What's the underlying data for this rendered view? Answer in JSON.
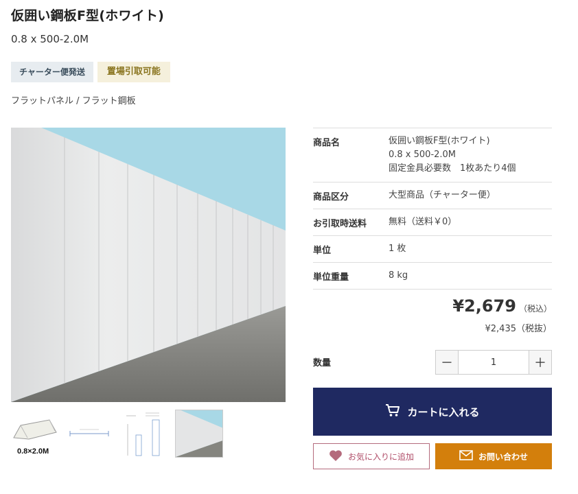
{
  "product": {
    "title": "仮囲い鋼板F型(ホワイト)",
    "subtitle": "0.8 x 500-2.0M",
    "badges": [
      "チャーター便発送",
      "置場引取可能"
    ],
    "category": {
      "items": [
        "フラットパネル",
        "フラット鋼板"
      ],
      "separator": " / "
    }
  },
  "gallery": {
    "thumb_caption": "0.8×2.0M"
  },
  "spec": [
    {
      "label": "商品名",
      "lines": [
        "仮囲い鋼板F型(ホワイト)",
        "0.8 x 500-2.0M",
        "固定金具必要数　1枚あたり4個"
      ]
    },
    {
      "label": "商品区分",
      "lines": [
        "大型商品（チャーター便）"
      ]
    },
    {
      "label": "お引取時送料",
      "lines": [
        "無料（送料￥0）"
      ]
    },
    {
      "label": "単位",
      "lines": [
        "1 枚"
      ]
    },
    {
      "label": "単位重量",
      "lines": [
        "8 kg"
      ]
    }
  ],
  "price": {
    "with_tax": "¥2,679",
    "with_tax_label": "（税込）",
    "without_tax": "¥2,435（税抜）"
  },
  "quantity": {
    "label": "数量",
    "value": "1",
    "minus": "－",
    "plus": "＋"
  },
  "buttons": {
    "cart": "カートに入れる",
    "favorite": "お気に入りに追加",
    "contact": "お問い合わせ"
  },
  "colors": {
    "cart": "#1f2961",
    "contact": "#d37f0c",
    "favorite": "#b04d68",
    "sky": "#a8d8e6"
  },
  "icons": {
    "cart": "cart-icon",
    "favorite": "heart-icon",
    "contact": "mail-icon"
  }
}
